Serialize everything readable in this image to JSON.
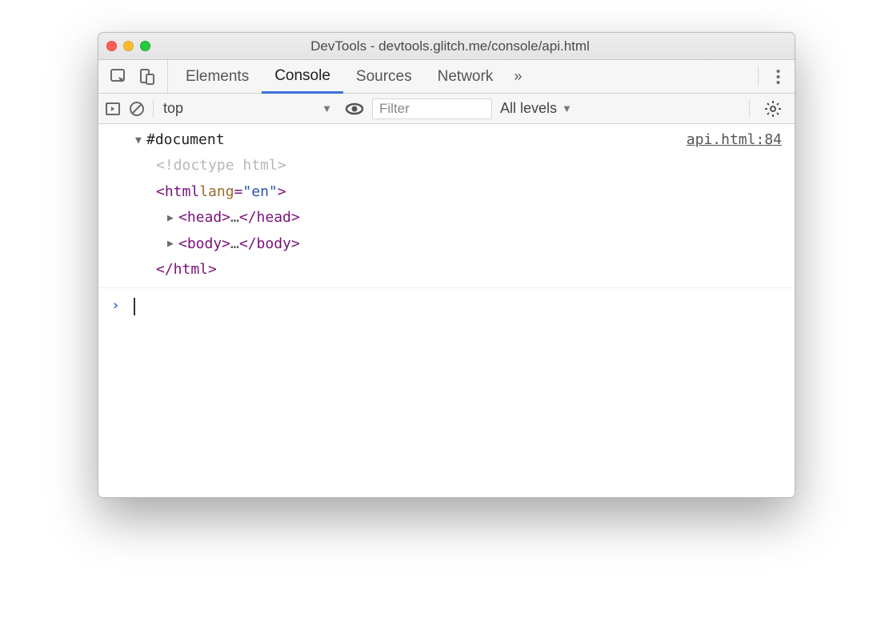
{
  "window": {
    "title": "DevTools - devtools.glitch.me/console/api.html"
  },
  "tabs": {
    "items": [
      "Elements",
      "Console",
      "Sources",
      "Network"
    ],
    "active_index": 1,
    "overflow_glyph": "»"
  },
  "toolbar": {
    "context": "top",
    "filter_placeholder": "Filter",
    "levels_label": "All levels"
  },
  "console": {
    "source_link": "api.html:84",
    "tree": {
      "root_label": "#document",
      "doctype_text": "<!doctype html>",
      "html_open_prefix": "<html ",
      "html_attr_name": "lang",
      "html_attr_equals": "=",
      "html_attr_value": "\"en\"",
      "html_open_suffix": ">",
      "head_open": "<head>",
      "head_ellipsis": "…",
      "head_close": "</head>",
      "body_open": "<body>",
      "body_ellipsis": "…",
      "body_close": "</body>",
      "html_close": "</html>"
    },
    "prompt_glyph": "›"
  }
}
